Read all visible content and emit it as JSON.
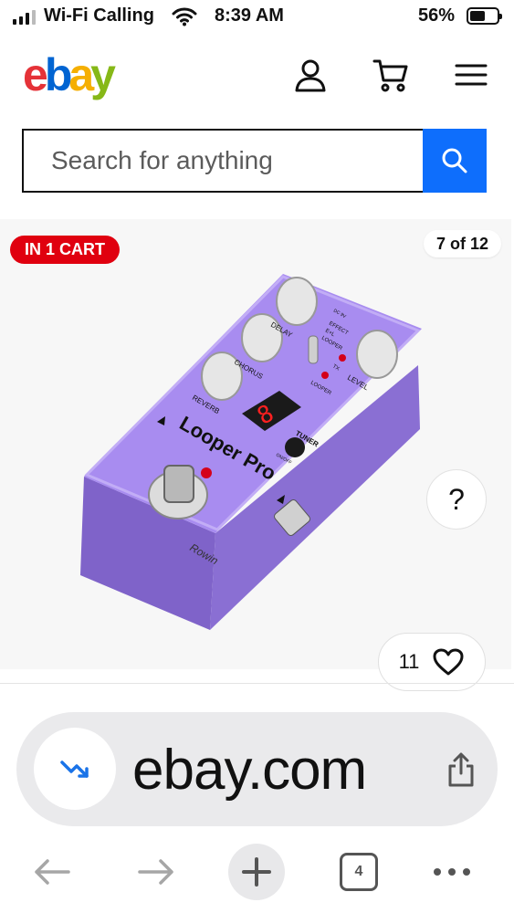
{
  "status_bar": {
    "carrier": "Wi-Fi Calling",
    "time": "8:39 AM",
    "battery_percent": "56%",
    "battery_level": 0.56
  },
  "header": {
    "logo_letters": [
      {
        "char": "e",
        "color": "#e53238"
      },
      {
        "char": "b",
        "color": "#0064d2"
      },
      {
        "char": "a",
        "color": "#f5af02"
      },
      {
        "char": "y",
        "color": "#86b817"
      }
    ],
    "icons": [
      "user-icon",
      "cart-icon",
      "menu-icon"
    ]
  },
  "search": {
    "placeholder": "Search for anything",
    "button_color": "#0e6efc"
  },
  "product_gallery": {
    "cart_badge": "IN 1 CART",
    "image_counter": "7 of 12",
    "help_label": "?",
    "watch_count": "11",
    "pedal": {
      "brand": "Rowin",
      "model": "Looper Pro",
      "knob_labels": [
        "REVERB",
        "CHORUS",
        "DELAY",
        "LEVEL"
      ],
      "switch_labels": [
        "EFFECT",
        "E+L",
        "LOOPER"
      ],
      "small_labels": [
        "TX",
        "LOOPER",
        "TUNER",
        "ON/OFF",
        "DC 9V"
      ],
      "color": "#9b7fe0"
    }
  },
  "browser": {
    "url": "ebay.com",
    "tab_count": "4"
  }
}
